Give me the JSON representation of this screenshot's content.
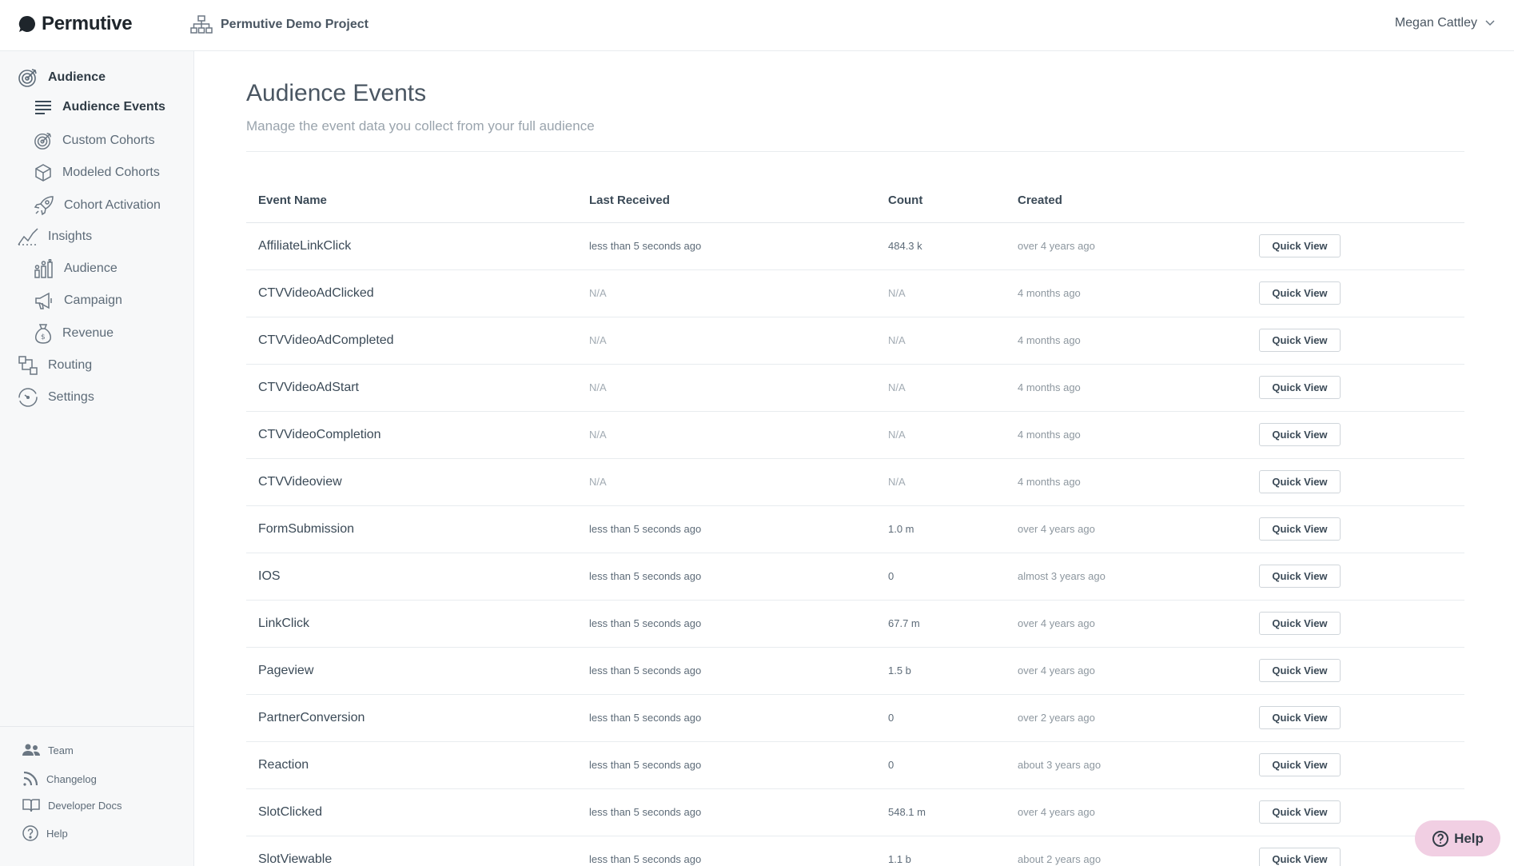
{
  "header": {
    "brand": "Permutive",
    "project": "Permutive Demo Project",
    "user": "Megan Cattley"
  },
  "sidebar": {
    "sections": [
      {
        "label": "Audience",
        "icon": "target-icon"
      },
      {
        "label": "Audience Events",
        "icon": "list-lines-icon"
      },
      {
        "label": "Custom Cohorts",
        "icon": "target-icon"
      },
      {
        "label": "Modeled Cohorts",
        "icon": "cube-icon"
      },
      {
        "label": "Cohort Activation",
        "icon": "rocket-icon"
      },
      {
        "label": "Insights",
        "icon": "trend-line-icon"
      },
      {
        "label": "Audience",
        "icon": "people-chart-icon"
      },
      {
        "label": "Campaign",
        "icon": "megaphone-icon"
      },
      {
        "label": "Revenue",
        "icon": "money-bag-icon"
      },
      {
        "label": "Routing",
        "icon": "routing-icon"
      },
      {
        "label": "Settings",
        "icon": "gauge-icon"
      }
    ],
    "footer": [
      {
        "label": "Team",
        "icon": "team-icon"
      },
      {
        "label": "Changelog",
        "icon": "rss-icon"
      },
      {
        "label": "Developer Docs",
        "icon": "book-icon"
      },
      {
        "label": "Help",
        "icon": "question-icon"
      }
    ]
  },
  "page": {
    "title": "Audience Events",
    "subtitle": "Manage the event data you collect from your full audience"
  },
  "table": {
    "headers": [
      "Event Name",
      "Last Received",
      "Count",
      "Created"
    ],
    "button_label": "Quick View",
    "rows": [
      {
        "name": "AffiliateLinkClick",
        "last": "less than 5 seconds ago",
        "count": "484.3 k",
        "created": "over 4 years ago"
      },
      {
        "name": "CTVVideoAdClicked",
        "last": "N/A",
        "count": "N/A",
        "created": "4 months ago"
      },
      {
        "name": "CTVVideoAdCompleted",
        "last": "N/A",
        "count": "N/A",
        "created": "4 months ago"
      },
      {
        "name": "CTVVideoAdStart",
        "last": "N/A",
        "count": "N/A",
        "created": "4 months ago"
      },
      {
        "name": "CTVVideoCompletion",
        "last": "N/A",
        "count": "N/A",
        "created": "4 months ago"
      },
      {
        "name": "CTVVideoview",
        "last": "N/A",
        "count": "N/A",
        "created": "4 months ago"
      },
      {
        "name": "FormSubmission",
        "last": "less than 5 seconds ago",
        "count": "1.0 m",
        "created": "over 4 years ago"
      },
      {
        "name": "IOS",
        "last": "less than 5 seconds ago",
        "count": "0",
        "created": "almost 3 years ago"
      },
      {
        "name": "LinkClick",
        "last": "less than 5 seconds ago",
        "count": "67.7 m",
        "created": "over 4 years ago"
      },
      {
        "name": "Pageview",
        "last": "less than 5 seconds ago",
        "count": "1.5 b",
        "created": "over 4 years ago"
      },
      {
        "name": "PartnerConversion",
        "last": "less than 5 seconds ago",
        "count": "0",
        "created": "over 2 years ago"
      },
      {
        "name": "Reaction",
        "last": "less than 5 seconds ago",
        "count": "0",
        "created": "about 3 years ago"
      },
      {
        "name": "SlotClicked",
        "last": "less than 5 seconds ago",
        "count": "548.1 m",
        "created": "over 4 years ago"
      },
      {
        "name": "SlotViewable",
        "last": "less than 5 seconds ago",
        "count": "1.1 b",
        "created": "about 2 years ago"
      }
    ]
  },
  "help_button": "Help",
  "colors": {
    "accent_pink": "#f1cfe3",
    "text": "#3b4a57",
    "muted": "#9aa4ad"
  }
}
